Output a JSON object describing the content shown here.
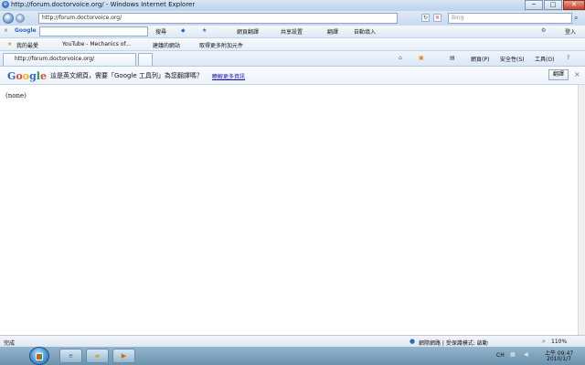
{
  "window": {
    "title": "http://forum.doctorvoice.org/ - Windows Internet Explorer",
    "controls": {
      "minimize": "─",
      "maximize": "□",
      "close": "✕"
    }
  },
  "addressbar": {
    "url": "http://forum.doctorvoice.org/",
    "search_placeholder": "Bing"
  },
  "toolbar": {
    "google_label": "Google",
    "search": "搜尋",
    "custom": "網頁翻譯",
    "share": "共享設置",
    "translate": "翻譯",
    "autofill": "自動填入",
    "signin": "登入"
  },
  "favorites": {
    "label": "我的最愛",
    "items": [
      "YouTube - Mechanics of...",
      "建議的網站",
      "取得更多附加元件"
    ]
  },
  "tab": {
    "title": "http://forum.doctorvoice.org/"
  },
  "command_bar": {
    "page": "網頁(P)",
    "safety": "安全性(S)",
    "tools": "工具(O)"
  },
  "google_translate_bar": {
    "logo": "Google",
    "message": "這是英文網頁，需要「Google 工具列」為您翻譯嗎？",
    "link": "瞭解更多資訊",
    "button": "翻譯"
  },
  "page": {
    "content": "(none)"
  },
  "statusbar": {
    "left": "完成",
    "security": "網際網路 | 受保護模式: 啟動",
    "zoom": "110%"
  },
  "taskbar": {
    "time": "上午 09:47",
    "date": "2010/1/7",
    "language": "CH"
  },
  "icons": {
    "back": "back-arrow-icon",
    "forward": "forward-arrow-icon",
    "refresh": "refresh-icon",
    "stop": "stop-icon"
  },
  "colors": {
    "ie_blue": "#3d6fa8",
    "google_blue": "#3366cc",
    "google_red": "#dd4b39",
    "google_yellow": "#f4b400",
    "google_green": "#0f9d58"
  }
}
